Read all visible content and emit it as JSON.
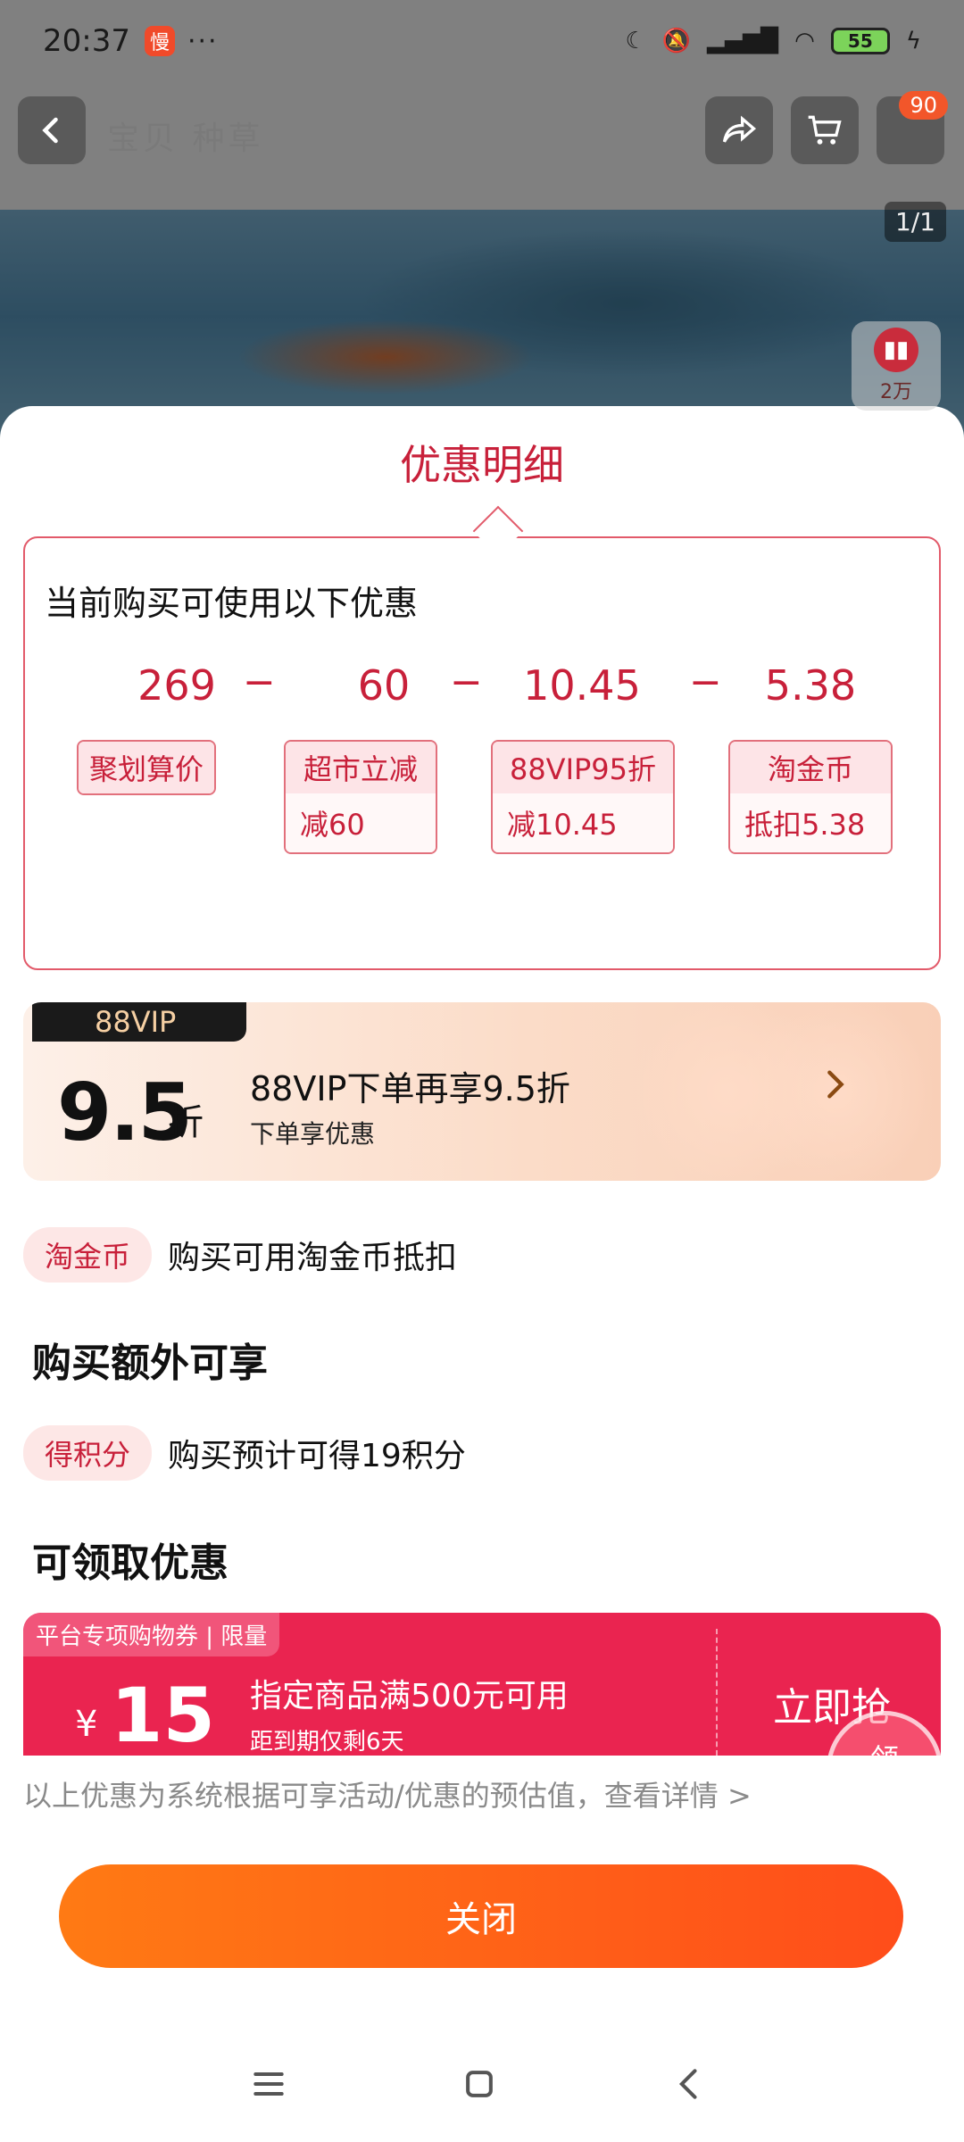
{
  "status_bar": {
    "time": "20:37",
    "app_badge": "慢",
    "dots": "···",
    "battery": "55"
  },
  "background": {
    "tabs": "宝贝 种草",
    "cart_badge": "90",
    "image_counter": "1/1",
    "like_count": "2万"
  },
  "sheet": {
    "title": "优惠明细",
    "calc_heading": "当前购买可使用以下优惠",
    "values": [
      "269",
      "60",
      "10.45",
      "5.38"
    ],
    "operators": [
      "−",
      "−",
      "−"
    ],
    "tags": [
      {
        "top": "聚划算价",
        "bottom": ""
      },
      {
        "top": "超市立减",
        "bottom": "减60"
      },
      {
        "top": "88VIP95折",
        "bottom": "减10.45"
      },
      {
        "top": "淘金币",
        "bottom": "抵扣5.38"
      }
    ]
  },
  "vip": {
    "badge": "88VIP",
    "rate": "9.5",
    "unit": "折",
    "title": "88VIP下单再享9.5折",
    "subtitle": "下单享优惠"
  },
  "coin_row": {
    "pill": "淘金币",
    "text": "购买可用淘金币抵扣"
  },
  "extra_section": {
    "title": "购买额外可享"
  },
  "points_row": {
    "pill": "得积分",
    "text": "购买预计可得19积分"
  },
  "claim_section": {
    "title": "可领取优惠"
  },
  "coupon": {
    "tag": "平台专项购物券 | 限量",
    "currency": "¥",
    "amount": "15",
    "title": "指定商品满500元可用",
    "subtitle": "距到期仅剩6天",
    "button": "立即抢",
    "stamp": "领"
  },
  "disclaimer": "以上优惠为系统根据可享活动/优惠的预估值，查看详情 >",
  "close_button": "关闭",
  "colors": {
    "accent_red": "#c8203a",
    "orange_start": "#ff7a14",
    "orange_end": "#ff4d1a",
    "coupon_red": "#ea2450"
  }
}
